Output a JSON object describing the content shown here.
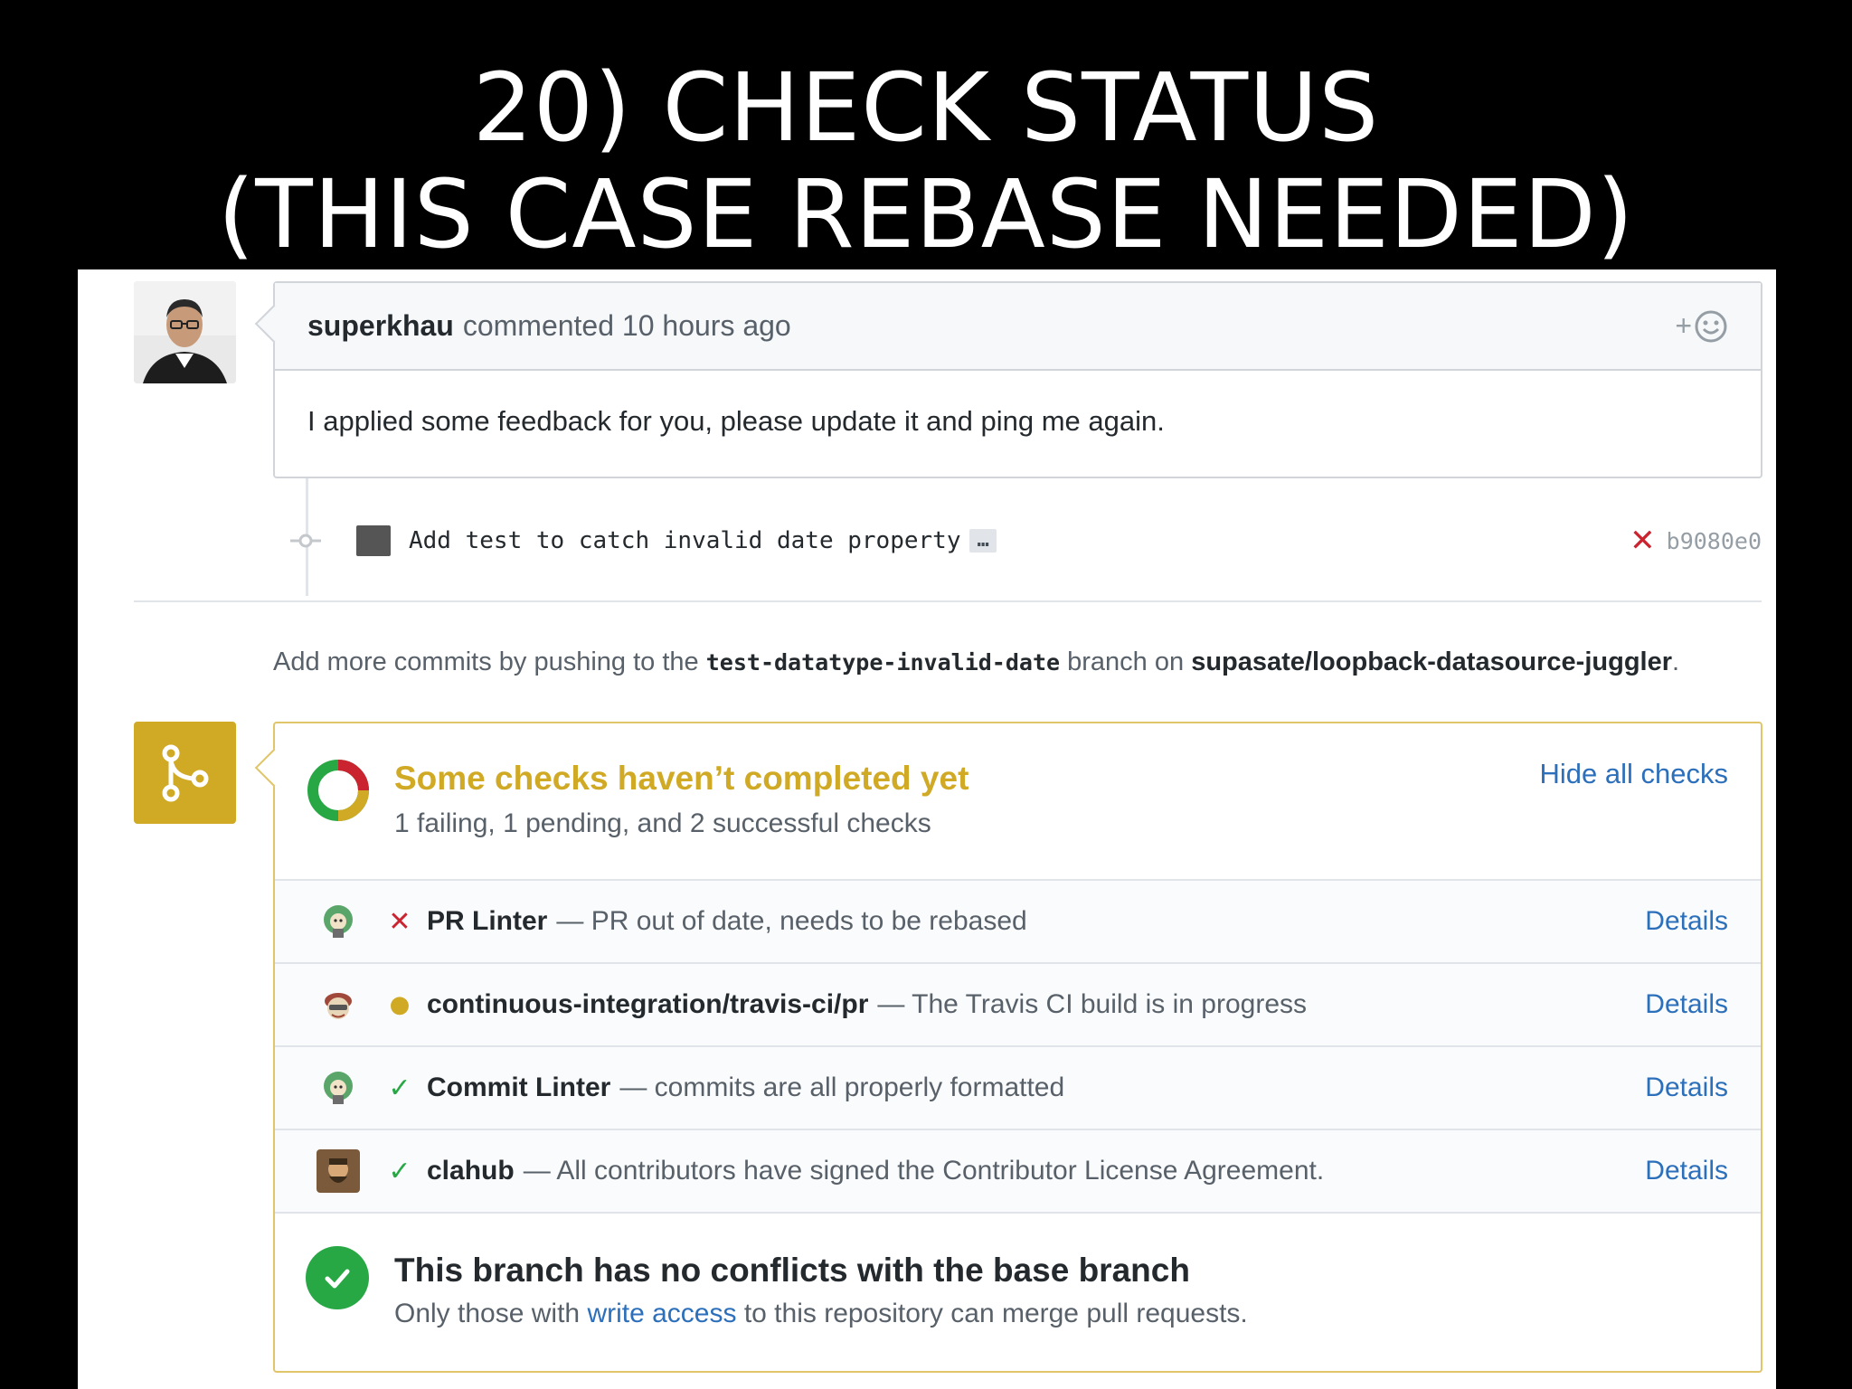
{
  "slide": {
    "title_line1": "20) CHECK STATUS",
    "title_line2": "(THIS CASE REBASE NEEDED)"
  },
  "comment": {
    "author": "superkhau",
    "action": "commented 10 hours ago",
    "reaction_plus": "+",
    "body": "I applied some feedback for you, please update it and ping me again."
  },
  "commit": {
    "message": "Add test to catch invalid date property",
    "ellipsis": "…",
    "status_icon": "x-icon",
    "sha": "b9080e0"
  },
  "push_hint": {
    "prefix": "Add more commits by pushing to the",
    "branch": "test-datatype-invalid-date",
    "middle": "branch on",
    "repo": "supasate/loopback-datasource-juggler",
    "suffix": "."
  },
  "checks": {
    "title": "Some checks haven’t completed yet",
    "subtitle": "1 failing, 1 pending, and 2 successful checks",
    "hide_label": "Hide all checks",
    "items": [
      {
        "status": "fail",
        "icon": "✕",
        "name": "PR Linter",
        "description": "— PR out of date, needs to be rebased",
        "link": "Details"
      },
      {
        "status": "pending",
        "icon": "●",
        "name": "continuous-integration/travis-ci/pr",
        "description": "— The Travis CI build is in progress",
        "link": "Details"
      },
      {
        "status": "success",
        "icon": "✓",
        "name": "Commit Linter",
        "description": "— commits are all properly formatted",
        "link": "Details"
      },
      {
        "status": "success",
        "icon": "✓",
        "name": "clahub",
        "description": "— All contributors have signed the Contributor License Agreement.",
        "link": "Details"
      }
    ]
  },
  "merge": {
    "title": "This branch has no conflicts with the base branch",
    "sub_prefix": "Only those with",
    "sub_link": "write access",
    "sub_suffix": "to this repository can merge pull requests."
  },
  "colors": {
    "accent_yellow": "#d0a925",
    "fail_red": "#cb2431",
    "success_green": "#28a745",
    "link_blue": "#2c6fbb"
  }
}
